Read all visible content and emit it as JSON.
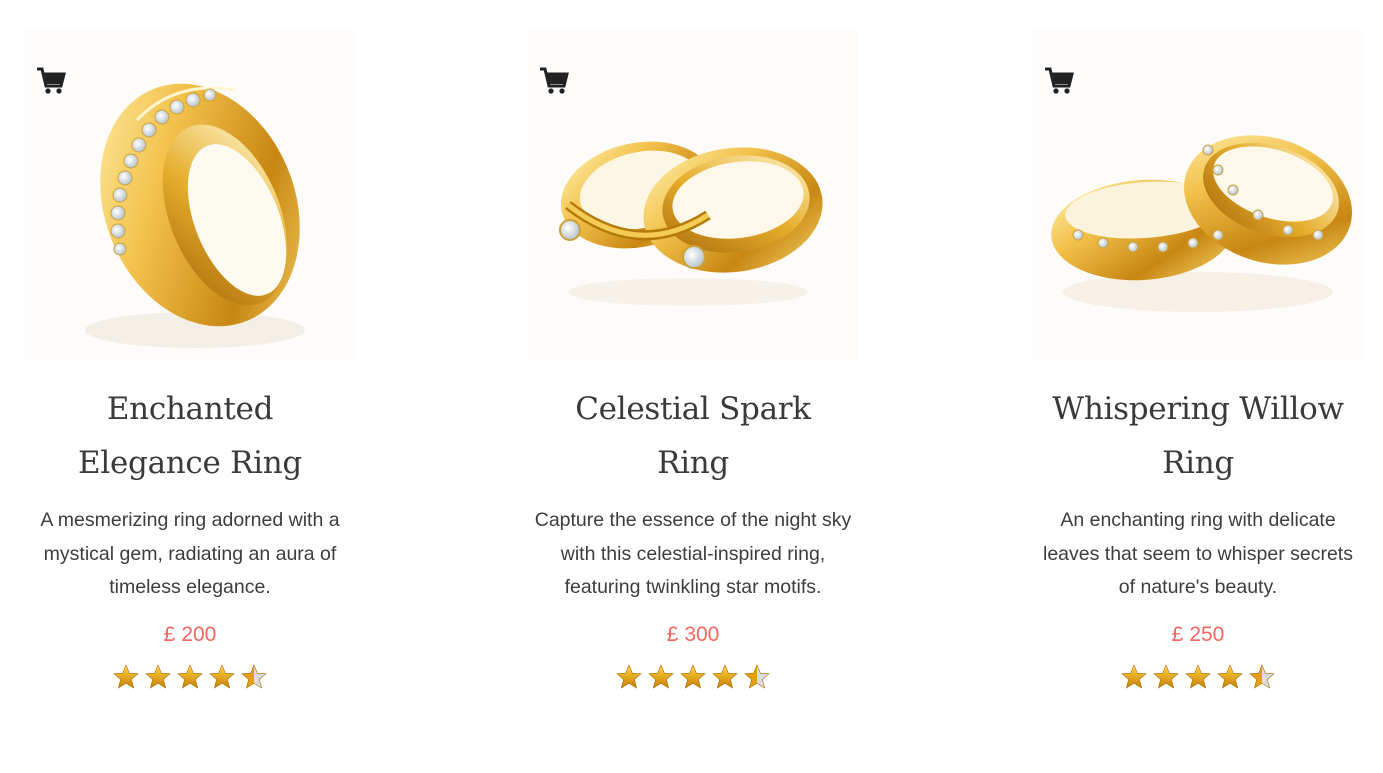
{
  "products": [
    {
      "title": "Enchanted Elegance Ring",
      "description": "A mesmerizing ring adorned with a mystical gem, radiating an aura of timeless elegance.",
      "currency": "£",
      "price": "200",
      "rating": 4.5,
      "rating_max": 5
    },
    {
      "title": "Celestial Spark Ring",
      "description": "Capture the essence of the night sky with this celestial-inspired ring, featuring twinkling star motifs.",
      "currency": "£",
      "price": "300",
      "rating": 4.5,
      "rating_max": 5
    },
    {
      "title": "Whispering Willow Ring",
      "description": "An enchanting ring with delicate leaves that seem to whisper secrets of nature's beauty.",
      "currency": "£",
      "price": "250",
      "rating": 4.5,
      "rating_max": 5
    }
  ],
  "icons": {
    "cart": "shopping-cart-icon",
    "star": "star-icon"
  },
  "colors": {
    "price": "#f06860",
    "star_gold": "#e8a317",
    "star_empty": "#d8d8d8",
    "gold": "#d9a425"
  }
}
